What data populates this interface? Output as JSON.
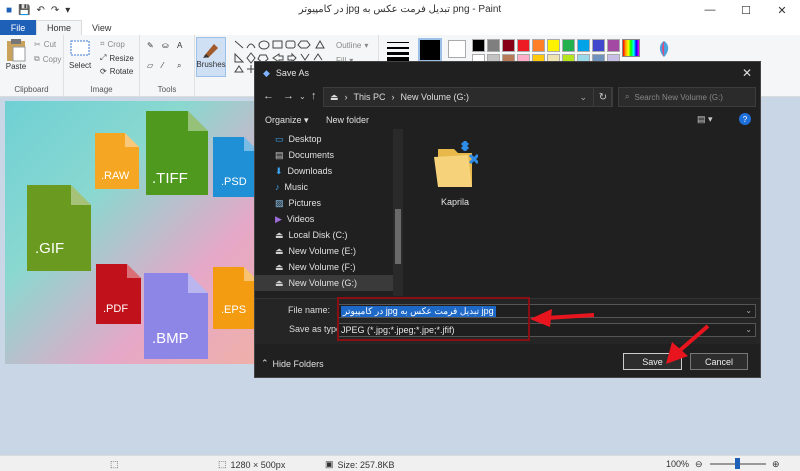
{
  "titlebar": {
    "title": "در کامپیوتر jpg تبدیل فرمت عکس به png - Paint",
    "controls": {
      "minimize": "—",
      "maximize": "☐",
      "close": "✕"
    }
  },
  "tabs": {
    "file": "File",
    "home": "Home",
    "view": "View"
  },
  "ribbon": {
    "clipboard": {
      "label": "Clipboard",
      "paste": "Paste",
      "cut": "Cut",
      "copy": "Copy"
    },
    "image": {
      "label": "Image",
      "select": "Select",
      "crop": "Crop",
      "resize": "Resize",
      "rotate": "Rotate"
    },
    "tools": {
      "label": "Tools"
    },
    "brushes": "Brushes",
    "shapes": {
      "outline": "Outline",
      "fill": "Fill"
    },
    "colors": {
      "color1": "#000000",
      "color2": "#ffffff",
      "palette": [
        "#000000",
        "#7f7f7f",
        "#880015",
        "#ed1c24",
        "#ff7f27",
        "#fff200",
        "#22b14c",
        "#00a2e8",
        "#3f48cc",
        "#a349a4",
        "#ffffff",
        "#c3c3c3",
        "#b97a57",
        "#ffaec9",
        "#ffc90e",
        "#efe4b0",
        "#b5e61d",
        "#99d9ea",
        "#7092be",
        "#c8bfe7"
      ]
    }
  },
  "canvas": {
    "icons": [
      {
        "label": ".RAW",
        "color": "#f5a623"
      },
      {
        "label": ".TIFF",
        "color": "#4f9a1e"
      },
      {
        "label": ".PSD",
        "color": "#1f8fd6"
      },
      {
        "label": ".GIF",
        "color": "#6a9a1f"
      },
      {
        "label": ".PDF",
        "color": "#c1121c"
      },
      {
        "label": ".BMP",
        "color": "#8e86e6"
      },
      {
        "label": ".EPS",
        "color": "#f39c12"
      }
    ]
  },
  "statusbar": {
    "dimensions": "1280 × 500px",
    "size": "Size: 257.8KB",
    "zoom": "100%"
  },
  "dialog": {
    "title": "Save As",
    "close": "✕",
    "address": {
      "root": "This PC",
      "location": "New Volume (G:)"
    },
    "search_placeholder": "Search New Volume (G:)",
    "toolbar": {
      "organize": "Organize",
      "new_folder": "New folder"
    },
    "nav_items": [
      {
        "label": "Desktop",
        "icon": "desktop-icon"
      },
      {
        "label": "Documents",
        "icon": "documents-icon"
      },
      {
        "label": "Downloads",
        "icon": "downloads-icon"
      },
      {
        "label": "Music",
        "icon": "music-icon"
      },
      {
        "label": "Pictures",
        "icon": "pictures-icon"
      },
      {
        "label": "Videos",
        "icon": "videos-icon"
      },
      {
        "label": "Local Disk (C:)",
        "icon": "drive-icon"
      },
      {
        "label": "New Volume (E:)",
        "icon": "drive-icon"
      },
      {
        "label": "New Volume (F:)",
        "icon": "drive-icon"
      },
      {
        "label": "New Volume (G:)",
        "icon": "drive-icon"
      }
    ],
    "folder": "Kaprila",
    "filename_label": "File name:",
    "filename_value": "در کامپیوتر jpg تبدیل فرمت عکس به jpg",
    "savetype_label": "Save as type:",
    "savetype_value": "JPEG (*.jpg;*.jpeg;*.jpe;*.jfif)",
    "hide_folders": "Hide Folders",
    "save": "Save",
    "cancel": "Cancel"
  },
  "annotation": {
    "color": "#e8141e"
  }
}
